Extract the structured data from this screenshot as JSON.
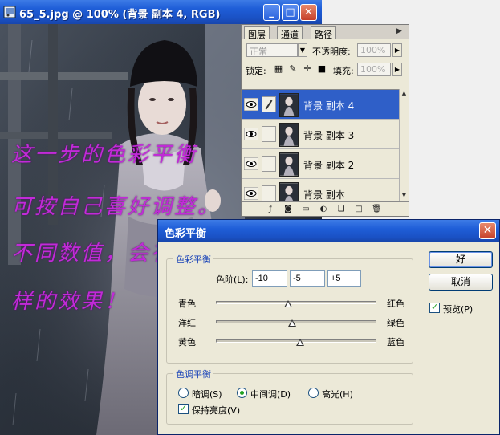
{
  "document_window": {
    "title": "65_5.jpg @ 100% (背景 副本 4, RGB)",
    "controls": {
      "minimize": "_",
      "maximize": "□",
      "close": "✕"
    }
  },
  "overlay_text": {
    "line1": "这一步的色彩平衡",
    "line2": "可按自己喜好调整。",
    "line3": "不同数值，会有不一",
    "line4": "样的效果！"
  },
  "layers_palette": {
    "tabs": [
      "图层",
      "通道",
      "路径"
    ],
    "blend_mode": "正常",
    "opacity_label": "不透明度:",
    "opacity_value": "100%",
    "lock_label": "锁定:",
    "fill_label": "填充:",
    "fill_value": "100%",
    "layers": [
      {
        "name": "背景 副本 4",
        "selected": true
      },
      {
        "name": "背景 副本 3",
        "selected": false
      },
      {
        "name": "背景 副本 2",
        "selected": false
      },
      {
        "name": "背景 副本",
        "selected": false
      }
    ]
  },
  "color_balance_dialog": {
    "title": "色彩平衡",
    "close": "✕",
    "color_balance_group": "色彩平衡",
    "levels_label": "色阶(L):",
    "level_values": [
      "-10",
      "-5",
      "+5"
    ],
    "sliders": [
      {
        "left_label": "青色",
        "right_label": "红色",
        "value": -10
      },
      {
        "left_label": "洋红",
        "right_label": "绿色",
        "value": -5
      },
      {
        "left_label": "黄色",
        "right_label": "蓝色",
        "value": 5
      }
    ],
    "tone_balance_group": "色调平衡",
    "tones": [
      {
        "label": "暗调(S)",
        "selected": false
      },
      {
        "label": "中间调(D)",
        "selected": true
      },
      {
        "label": "高光(H)",
        "selected": false
      }
    ],
    "preserve_luminosity_label": "保持亮度(V)",
    "preserve_luminosity_checked": true,
    "ok_label": "好",
    "cancel_label": "取消",
    "preview_label": "预览(P)",
    "preview_checked": true
  },
  "colors": {
    "title_bar": "#1f5ed8",
    "overlay_text": "#c22ad8",
    "selected_layer": "#2f5fc8",
    "group_legend": "#1c45b8"
  }
}
